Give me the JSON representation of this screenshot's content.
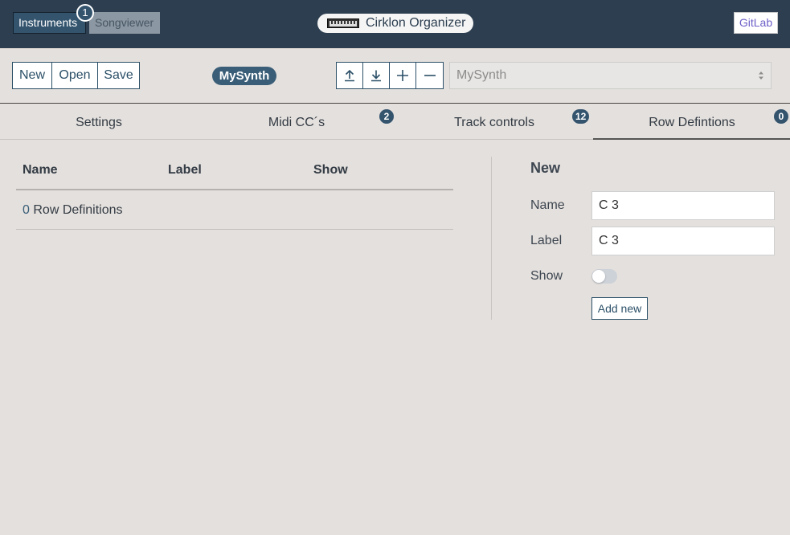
{
  "header": {
    "nav": [
      {
        "label": "Instruments",
        "active": true
      },
      {
        "label": "Songviewer",
        "active": false
      }
    ],
    "nav_badge": "1",
    "app_title": "Cirklon Organizer",
    "gitlab_label": "GitLab",
    "colors": {
      "bar": "#2c3e50",
      "accent": "#34546e"
    }
  },
  "toolbar": {
    "file_buttons": [
      "New",
      "Open",
      "Save"
    ],
    "current_instrument": "MySynth",
    "icon_buttons": [
      "upload-icon",
      "download-icon",
      "plus-icon",
      "minus-icon"
    ],
    "instrument_select": {
      "selected": "MySynth"
    }
  },
  "tabs": [
    {
      "label": "Settings",
      "badge": null,
      "active": false
    },
    {
      "label": "Midi CC´s",
      "badge": "2",
      "active": false
    },
    {
      "label": "Track controls",
      "badge": "12",
      "active": false
    },
    {
      "label": "Row Defintions",
      "badge": "0",
      "active": true
    }
  ],
  "table": {
    "columns": [
      "Name",
      "Label",
      "Show"
    ],
    "count_value": "0",
    "count_label": "Row Definitions"
  },
  "form": {
    "title": "New",
    "name_label": "Name",
    "name_value": "C 3",
    "label_label": "Label",
    "label_value": "C 3",
    "show_label": "Show",
    "show_value": false,
    "submit_label": "Add new"
  }
}
